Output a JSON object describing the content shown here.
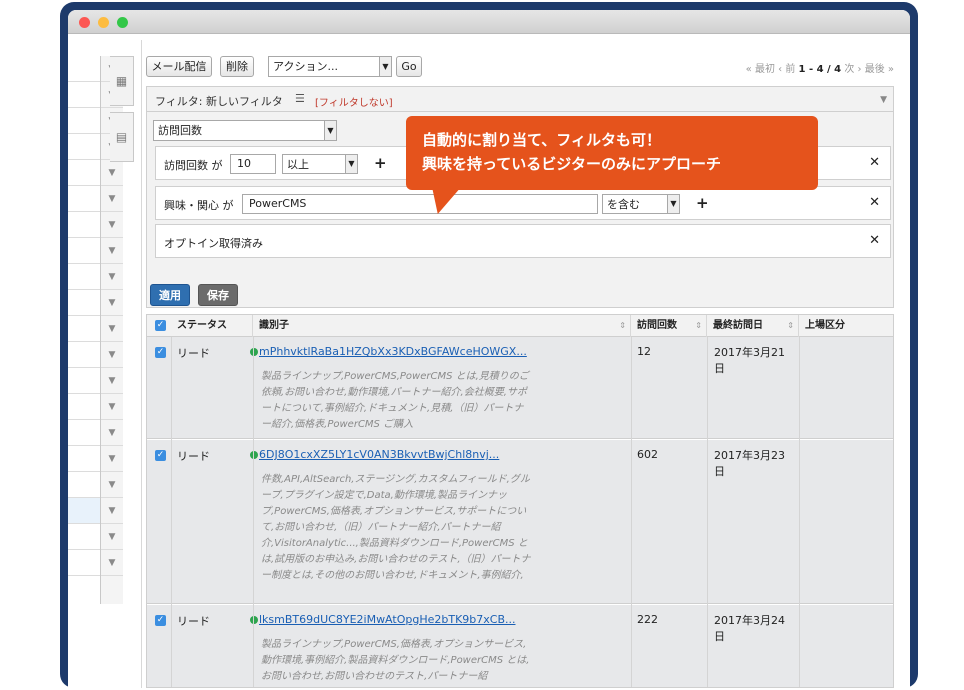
{
  "toolbar": {
    "mail_button": "メール配信",
    "delete_button": "削除",
    "action_select": "アクション...",
    "go_button": "Go"
  },
  "pager": {
    "first": "« 最初",
    "prev": "‹ 前",
    "range": "1 - 4 / 4",
    "next": "次 ›",
    "last": "最後 »"
  },
  "filter": {
    "label": "フィルタ: 新しいフィルタ",
    "no_filter": "[フィルタしない]",
    "field_select": "訪問回数",
    "conditions": [
      {
        "label": "訪問回数 が",
        "value": "10",
        "operator": "以上"
      },
      {
        "label": "興味・関心 が",
        "value": "PowerCMS",
        "operator": "を含む"
      },
      {
        "label": "オプトイン取得済み"
      }
    ],
    "apply_button": "適用",
    "save_button": "保存"
  },
  "table": {
    "headers": [
      "ステータス",
      "識別子",
      "訪問回数",
      "最終訪問日",
      "上場区分"
    ],
    "rows": [
      {
        "status": "リード",
        "identifier": "mPhhvktlRaBa1HZQbXx3KDxBGFAWceHOWGX...",
        "visits": "12",
        "last_visit": "2017年3月21日",
        "tags": "製品ラインナップ,PowerCMS,PowerCMS とは,見積りのご依頼,お問い合わせ,動作環境,パートナー紹介,会社概要,サポートについて,事例紹介,ドキュメント,見積,（旧）パートナー紹介,価格表,PowerCMS ご購入"
      },
      {
        "status": "リード",
        "identifier": "6DJ8O1cxXZ5LY1cV0AN3BkvvtBwjChl8nvj...",
        "visits": "602",
        "last_visit": "2017年3月23日",
        "tags": "件数,API,AltSearch,ステージング,カスタムフィールド,グループ,プラグイン設定で,Data,動作環境,製品ラインナップ,PowerCMS,価格表,オプションサービス,サポートについて,お問い合わせ,（旧）パートナー紹介,パートナー紹介,VisitorAnalytic...,製品資料ダウンロード,PowerCMS とは,試用版のお申込み,お問い合わせのテスト,（旧）パートナー制度とは,その他のお問い合わせ,ドキュメント,事例紹介,"
      },
      {
        "status": "リード",
        "identifier": "lksmBT69dUC8YE2iMwAtOpgHe2bTK9b7xCB...",
        "visits": "222",
        "last_visit": "2017年3月24日",
        "tags": "製品ラインナップ,PowerCMS,価格表,オプションサービス,動作環境,事例紹介,製品資料ダウンロード,PowerCMS とは,お問い合わせ,お問い合わせのテスト,パートナー紹"
      }
    ]
  },
  "callout": {
    "line1": "自動的に割り当て、フィルタも可！",
    "line2": "興味を持っているビジターのみにアプローチ"
  },
  "colors": {
    "frame": "#1d3a6b",
    "callout": "#e5531c",
    "apply": "#2f6fb0",
    "save": "#6b6b6b",
    "link": "#1a5fb4"
  }
}
